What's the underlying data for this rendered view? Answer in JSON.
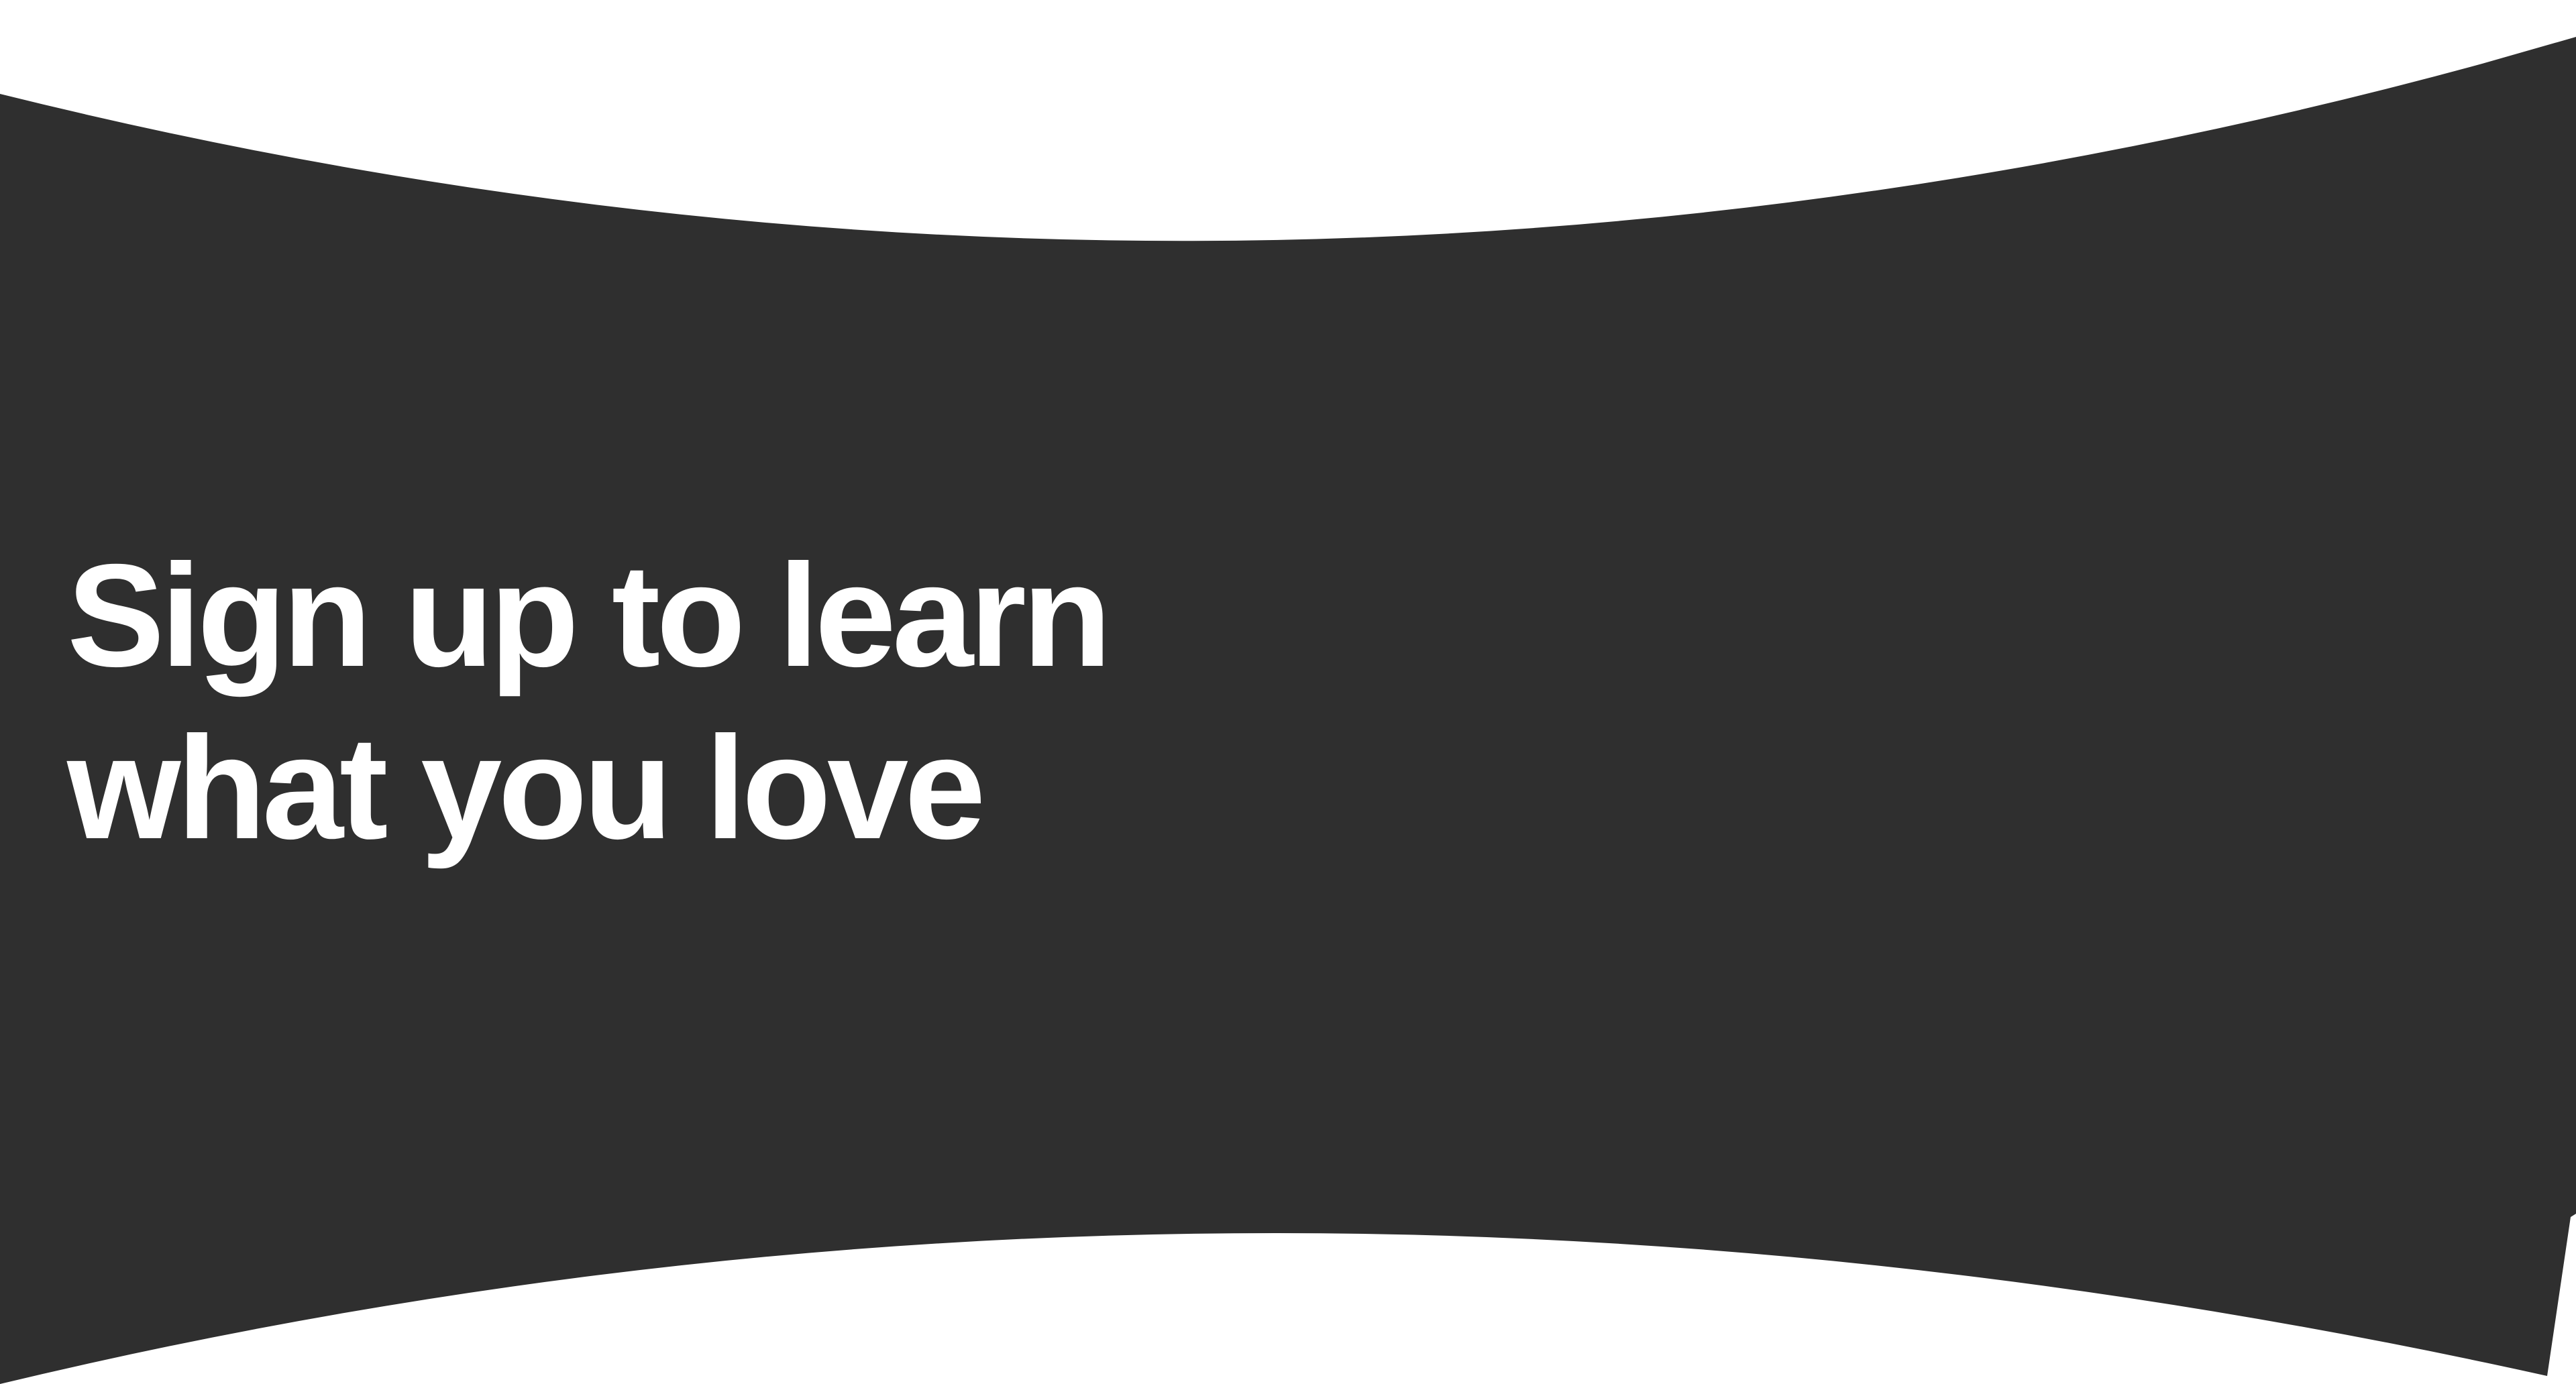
{
  "banner": {
    "background_color": "#2f2f2f",
    "text_color": "#ffffff",
    "headline_line_1": "Sign up to learn",
    "headline_line_2": "what you love"
  }
}
